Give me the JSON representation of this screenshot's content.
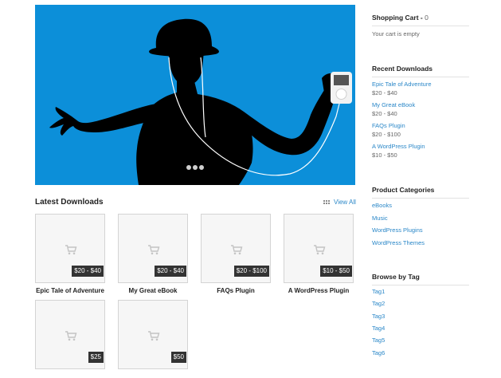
{
  "hero": {
    "slide_dots": 3,
    "background_color": "#0c8fd9"
  },
  "latest": {
    "title": "Latest Downloads",
    "view_all": "View All",
    "products": [
      {
        "name": "Epic Tale of Adventure",
        "price": "$20 - $40"
      },
      {
        "name": "My Great eBook",
        "price": "$20 - $40"
      },
      {
        "name": "FAQs Plugin",
        "price": "$20 - $100"
      },
      {
        "name": "A WordPress Plugin",
        "price": "$10 - $50"
      },
      {
        "name": "",
        "price": "$25"
      },
      {
        "name": "",
        "price": "$50"
      }
    ]
  },
  "sidebar": {
    "cart": {
      "title": "Shopping Cart -",
      "count": "0",
      "empty_text": "Your cart is empty"
    },
    "recent": {
      "title": "Recent Downloads",
      "items": [
        {
          "name": "Epic Tale of Adventure",
          "price": "$20 - $40"
        },
        {
          "name": "My Great eBook",
          "price": "$20 - $40"
        },
        {
          "name": "FAQs Plugin",
          "price": "$20 - $100"
        },
        {
          "name": "A WordPress Plugin",
          "price": "$10 - $50"
        }
      ]
    },
    "categories": {
      "title": "Product Categories",
      "items": [
        "eBooks",
        "Music",
        "WordPress Plugins",
        "WordPress Themes"
      ]
    },
    "tags": {
      "title": "Browse by Tag",
      "items": [
        "Tag1",
        "Tag2",
        "Tag3",
        "Tag4",
        "Tag5",
        "Tag6"
      ]
    }
  },
  "colors": {
    "link": "#2a87c8",
    "price_badge": "#333333",
    "hero_blue": "#0c8fd9"
  }
}
